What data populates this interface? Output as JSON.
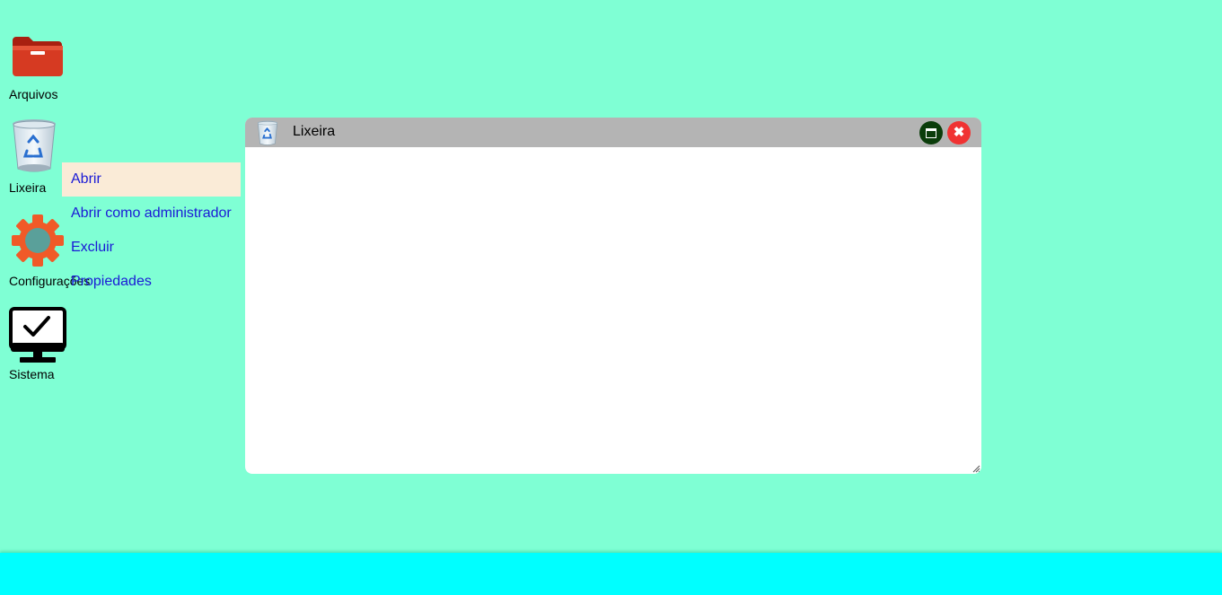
{
  "desktop": {
    "icons": [
      {
        "label": "Arquivos",
        "icon": "folder-icon"
      },
      {
        "label": "Lixeira",
        "icon": "recycle-bin-icon"
      },
      {
        "label": "Configurações",
        "icon": "gear-icon"
      },
      {
        "label": "Sistema",
        "icon": "monitor-check-icon"
      }
    ]
  },
  "context_menu": {
    "items": [
      {
        "label": "Abrir",
        "highlighted": true
      },
      {
        "label": "Abrir como administrador"
      },
      {
        "label": "Excluir"
      },
      {
        "label": "Propiedades"
      }
    ]
  },
  "window": {
    "title": "Lixeira",
    "icon": "recycle-bin-icon",
    "maximize_icon": "maximize-icon",
    "close_glyph": "✖"
  },
  "colors": {
    "desktop_bg": "#7fffd4",
    "taskbar_bg": "#00ffff",
    "titlebar_bg": "#b4b4b4",
    "menu_highlight": "#faebd7",
    "menu_text": "#1a1ad6",
    "close_button": "#f03232",
    "maximize_button": "#0b3d0b"
  }
}
